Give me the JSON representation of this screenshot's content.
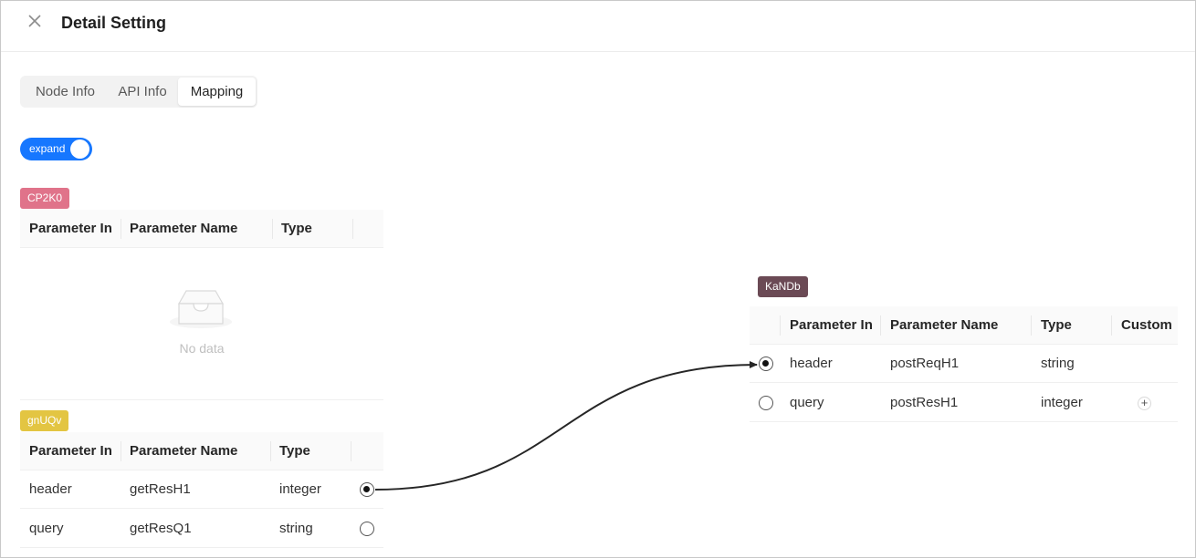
{
  "window": {
    "title": "Detail Setting"
  },
  "tabs": [
    {
      "label": "Node Info"
    },
    {
      "label": "API Info"
    },
    {
      "label": "Mapping"
    }
  ],
  "toggle": {
    "label": "expand",
    "on": true
  },
  "colors": {
    "accent": "#1677ff",
    "tag_cp2k0": "#e0738a",
    "tag_gnuqv": "#e3c542",
    "tag_kandb": "#6b4a55"
  },
  "source_nodes": [
    {
      "tag": "CP2K0",
      "columns": [
        "Parameter In",
        "Parameter Name",
        "Type"
      ],
      "rows": [],
      "empty_text": "No data"
    },
    {
      "tag": "gnUQv",
      "columns": [
        "Parameter In",
        "Parameter Name",
        "Type"
      ],
      "rows": [
        {
          "in": "header",
          "name": "getResH1",
          "type": "integer",
          "selected": true
        },
        {
          "in": "query",
          "name": "getResQ1",
          "type": "string",
          "selected": false
        }
      ]
    }
  ],
  "target_node": {
    "tag": "KaNDb",
    "columns": [
      "Parameter In",
      "Parameter Name",
      "Type",
      "Custom"
    ],
    "rows": [
      {
        "in": "header",
        "name": "postReqH1",
        "type": "string",
        "selected": true,
        "custom": ""
      },
      {
        "in": "query",
        "name": "postResH1",
        "type": "integer",
        "selected": false,
        "custom": "+"
      }
    ]
  },
  "mapping": {
    "from": "gnUQv.header.getResH1",
    "to": "KaNDb.header.postReqH1"
  }
}
